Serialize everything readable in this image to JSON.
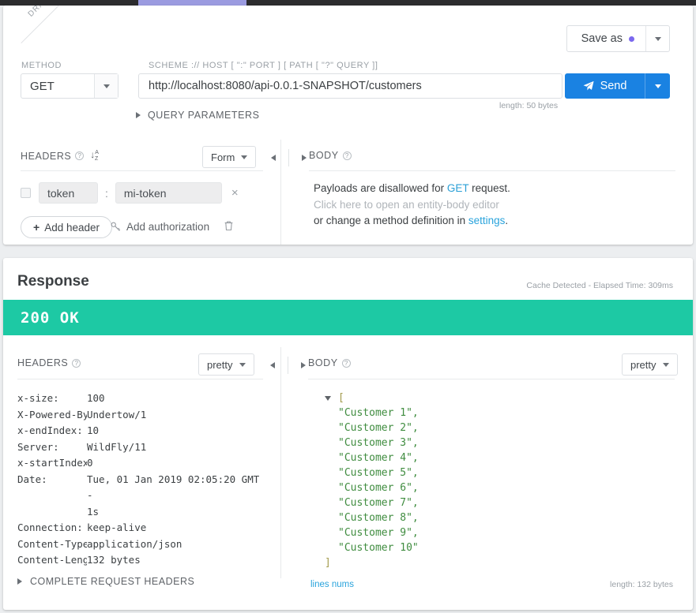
{
  "window": {
    "tab_accent_color": "#9b9be0",
    "chrome_color": "#2c2c2e"
  },
  "request": {
    "draft_ribbon": "DRAFT",
    "save_as": {
      "label": "Save as",
      "dot_color": "#7b68ee"
    },
    "method": {
      "label": "METHOD",
      "value": "GET"
    },
    "url": {
      "label": "SCHEME :// HOST [ \":\" PORT ] [ PATH [ \"?\" QUERY ]]",
      "value": "http://localhost:8080/api-0.0.1-SNAPSHOT/customers",
      "length": "length: 50 bytes"
    },
    "send": {
      "label": "Send",
      "color": "#1a82e2"
    },
    "query_parameters": {
      "label": "QUERY PARAMETERS"
    },
    "headers_panel": {
      "title": "HEADERS",
      "help": "?",
      "sort_icon": "sort-alpha-icon",
      "format_select": "Form",
      "rows": [
        {
          "key": "token",
          "value": "mi-token",
          "separator": ":",
          "remove": "×"
        }
      ],
      "add_header": "Add header",
      "add_authorization": "Add authorization",
      "delete_all": "delete-all-icon"
    },
    "body_panel": {
      "title": "BODY",
      "help": "?",
      "line1_pre": "Payloads are disallowed for ",
      "line1_link": "GET",
      "line1_post": " request.",
      "line2": "Click here to open an entity-body editor",
      "line3_pre": "or change a method definition in ",
      "line3_link": "settings",
      "line3_post": "."
    }
  },
  "response": {
    "title": "Response",
    "meta": "Cache Detected - Elapsed Time: 309ms",
    "status": {
      "text": "200 OK",
      "color": "#1dc9a4"
    },
    "headers_panel": {
      "title": "HEADERS",
      "help": "?",
      "format_select": "pretty",
      "items": [
        {
          "key": "x-size:",
          "value": "100"
        },
        {
          "key": "X-Powered-By:",
          "value": "Undertow/1"
        },
        {
          "key": "x-endIndex:",
          "value": "10"
        },
        {
          "key": "Server:",
          "value": "WildFly/11"
        },
        {
          "key": "x-startIndex:",
          "value": "0"
        },
        {
          "key": "Date:",
          "value": "Tue, 01 Jan 2019 02:05:20 GMT -\n1s"
        },
        {
          "key": "Connection:",
          "value": "keep-alive"
        },
        {
          "key": "Content-Type:",
          "value": "application/json"
        },
        {
          "key": "Content-Leng…",
          "value": "132 bytes"
        }
      ],
      "complete_request_headers": "COMPLETE REQUEST HEADERS"
    },
    "body_panel": {
      "title": "BODY",
      "help": "?",
      "format_select": "pretty",
      "open_bracket": "[",
      "close_bracket": "]",
      "items": [
        "\"Customer 1\",",
        "\"Customer 2\",",
        "\"Customer 3\",",
        "\"Customer 4\",",
        "\"Customer 5\",",
        "\"Customer 6\",",
        "\"Customer 7\",",
        "\"Customer 8\",",
        "\"Customer 9\",",
        "\"Customer 10\""
      ],
      "lines_nums": "lines nums",
      "length": "length: 132 bytes"
    }
  }
}
